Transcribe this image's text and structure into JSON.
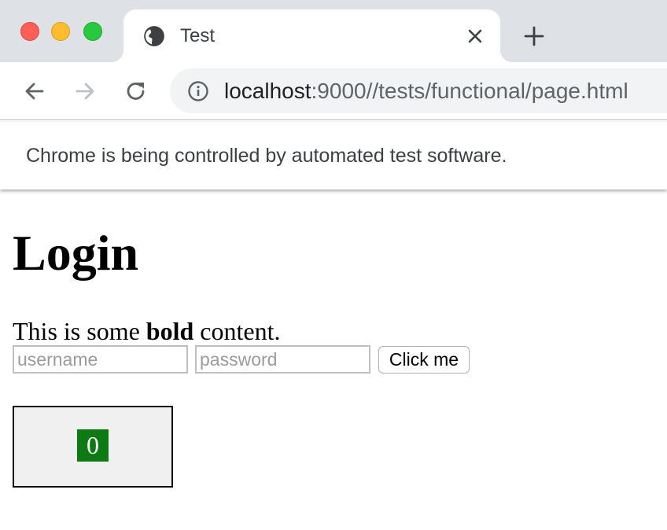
{
  "browser": {
    "tab_title": "Test",
    "url_host": "localhost",
    "url_rest": ":9000//tests/functional/page.html",
    "infobar_text": "Chrome is being controlled by automated test software."
  },
  "page": {
    "title": "Login",
    "para_before": "This is some ",
    "para_bold": "bold",
    "para_after": " content.",
    "username_placeholder": "username",
    "password_placeholder": "password",
    "button_label": "Click me",
    "counter_value": "0"
  },
  "colors": {
    "tabstrip": "#dee1e6",
    "omnibox": "#f1f3f4",
    "counter_badge": "#0e7a14",
    "counter_box": "#f0f0f0"
  },
  "icons": {
    "favicon": "globe-icon",
    "tab_close": "close-icon",
    "new_tab": "plus-icon",
    "back": "arrow-left-icon",
    "forward": "arrow-right-icon",
    "reload": "reload-icon",
    "site_info": "info-icon"
  }
}
